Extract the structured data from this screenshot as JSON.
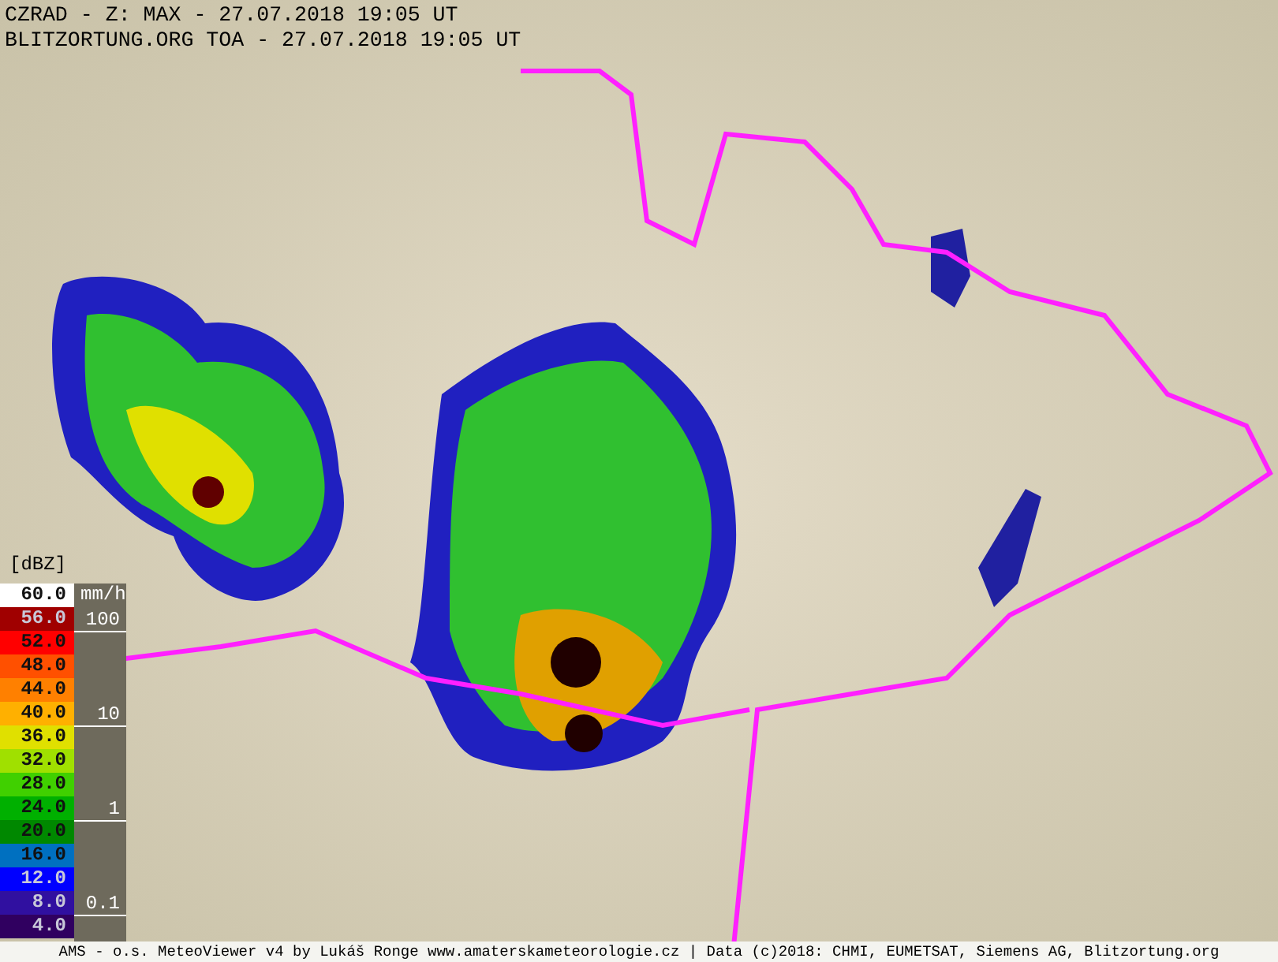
{
  "header": {
    "lines": [
      "CZRAD - Z: MAX - 27.07.2018 19:05 UT",
      "BLITZORTUNG.ORG TOA - 27.07.2018 19:05 UT"
    ]
  },
  "legend": {
    "unit_label": "[dBZ]",
    "rate_unit": "mm/h",
    "levels": [
      {
        "label": "60.0",
        "color": "#ffffff"
      },
      {
        "label": "56.0",
        "color": "#a00000",
        "rate_mark": "100"
      },
      {
        "label": "52.0",
        "color": "#ff0000"
      },
      {
        "label": "48.0",
        "color": "#ff5000"
      },
      {
        "label": "44.0",
        "color": "#ff8000"
      },
      {
        "label": "40.0",
        "color": "#ffb000",
        "rate_mark": "10"
      },
      {
        "label": "36.0",
        "color": "#e0e000"
      },
      {
        "label": "32.0",
        "color": "#a0e000"
      },
      {
        "label": "28.0",
        "color": "#40d000"
      },
      {
        "label": "24.0",
        "color": "#00b000",
        "rate_mark": "1"
      },
      {
        "label": "20.0",
        "color": "#008800"
      },
      {
        "label": "16.0",
        "color": "#0070c0"
      },
      {
        "label": "12.0",
        "color": "#0000ff"
      },
      {
        "label": "8.0",
        "color": "#3010a0",
        "rate_mark": "0.1"
      },
      {
        "label": "4.0",
        "color": "#300060"
      }
    ]
  },
  "footer": {
    "text": "AMS - o.s. MeteoViewer v4 by Lukáš Ronge www.amaterskameteorologie.cz | Data (c)2018: CHMI, EUMETSAT, Siemens AG, Blitzortung.org"
  }
}
